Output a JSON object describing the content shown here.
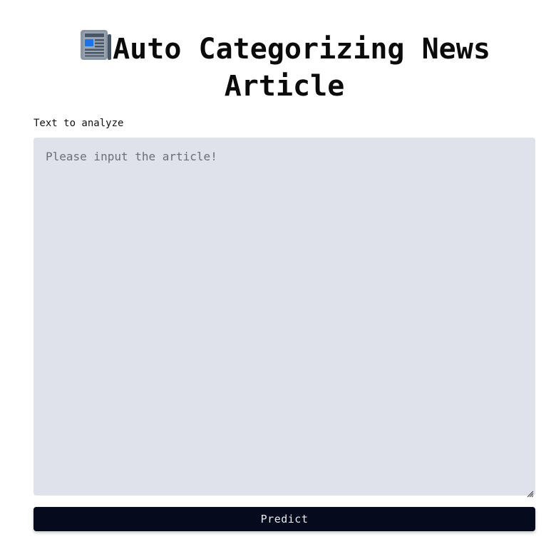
{
  "header": {
    "title": "Auto Categorizing News Article",
    "icon": "newspaper-icon"
  },
  "form": {
    "field_label": "Text to analyze",
    "textarea_value": "",
    "textarea_placeholder": "Please input the article!",
    "submit_label": "Predict"
  },
  "colors": {
    "textarea_background": "#dfe2ea",
    "button_background": "#050a1c",
    "button_text": "#e8eaf0"
  }
}
